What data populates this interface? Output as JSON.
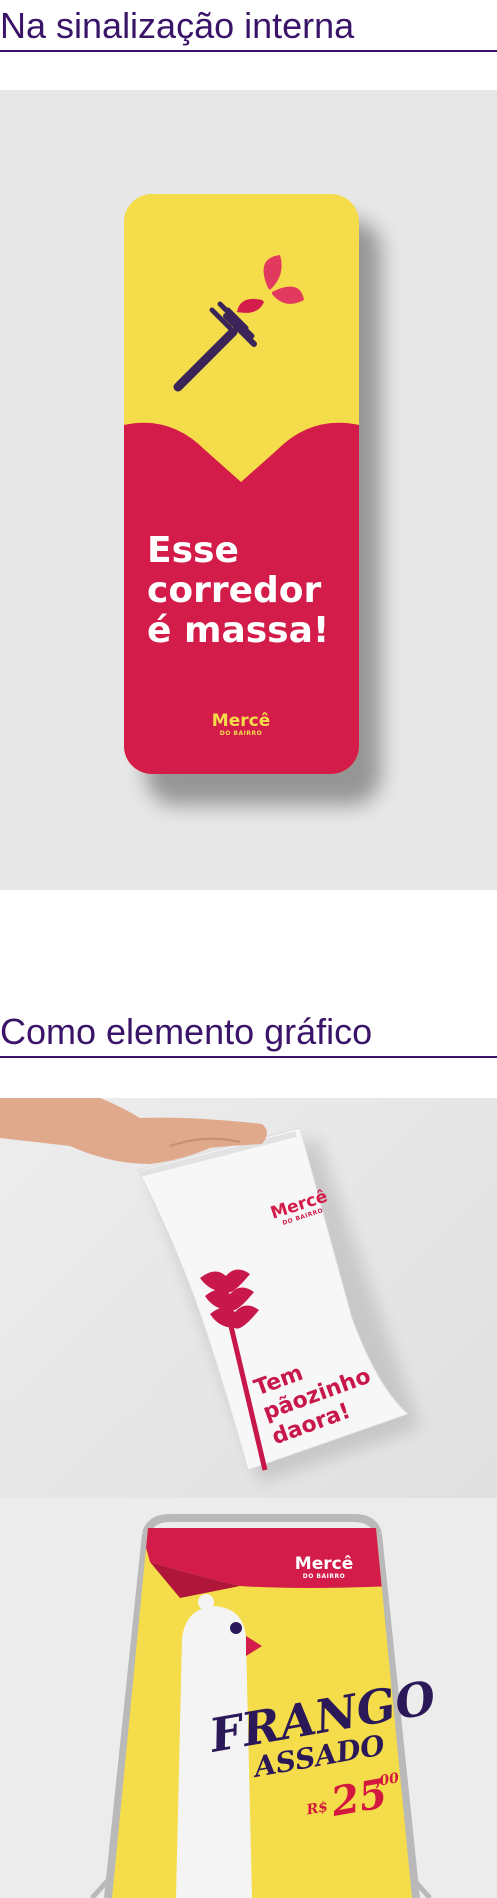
{
  "sections": [
    {
      "title": "Na sinalização interna",
      "sign": {
        "headline_lines": [
          "Esse",
          "corredor",
          "é massa!"
        ],
        "logo": {
          "name": "Mercê",
          "sub": "DO BAIRRO"
        }
      }
    },
    {
      "title": "Como elemento gráfico",
      "bag": {
        "logo": {
          "name": "Mercê",
          "sub": "DO BAIRRO"
        },
        "text_lines": [
          "Tem",
          "pãozinho",
          "daora!"
        ]
      },
      "board": {
        "logo": {
          "name": "Mercê",
          "sub": "DO BAIRRO"
        },
        "headline_1": "FRANGO",
        "headline_2": "ASSADO",
        "currency": "R$",
        "price": "25",
        "cents": ",00"
      }
    }
  ],
  "colors": {
    "title": "#3a1468",
    "brand_red": "#d41c4a",
    "brand_yellow": "#f4dc4a",
    "brand_purple": "#3a2458"
  },
  "icons": [
    "fork-icon",
    "butterfly-icon",
    "chicken-icon"
  ]
}
